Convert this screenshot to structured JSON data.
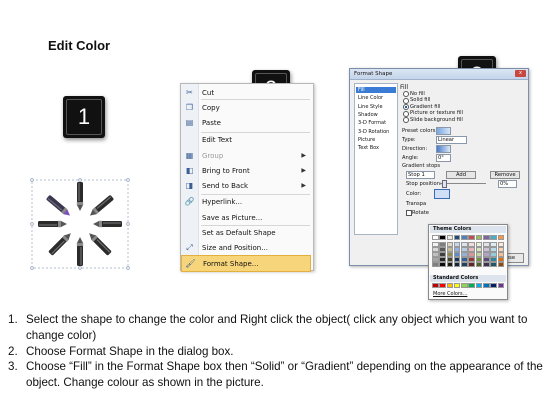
{
  "title": "Edit Color",
  "badges": [
    "1",
    "2",
    "3"
  ],
  "context_menu": {
    "items": [
      {
        "label": "Cut",
        "icon": "scissors-icon",
        "glyph": "✂",
        "enabled": true
      },
      {
        "label": "Copy",
        "icon": "copy-icon",
        "glyph": "❐",
        "enabled": true
      },
      {
        "label": "Paste",
        "icon": "paste-icon",
        "glyph": "▤",
        "enabled": true
      },
      {
        "label": "Edit Text",
        "icon": "edit-text-icon",
        "glyph": "",
        "enabled": true
      },
      {
        "label": "Group",
        "icon": "group-icon",
        "glyph": "▦",
        "enabled": false,
        "submenu": true
      },
      {
        "label": "Bring to Front",
        "icon": "bring-to-front-icon",
        "glyph": "◧",
        "enabled": true,
        "submenu": true
      },
      {
        "label": "Send to Back",
        "icon": "send-to-back-icon",
        "glyph": "◨",
        "enabled": true,
        "submenu": true
      },
      {
        "label": "Hyperlink...",
        "icon": "hyperlink-icon",
        "glyph": "🔗",
        "enabled": true
      },
      {
        "label": "Save as Picture...",
        "icon": "",
        "glyph": "",
        "enabled": true
      },
      {
        "label": "Set as Default Shape",
        "icon": "",
        "glyph": "",
        "enabled": true
      },
      {
        "label": "Size and Position...",
        "icon": "size-position-icon",
        "glyph": "⤢",
        "enabled": true
      },
      {
        "label": "Format Shape...",
        "icon": "format-shape-icon",
        "glyph": "🖌",
        "enabled": true,
        "selected": true
      }
    ]
  },
  "format_dialog": {
    "title": "Format Shape",
    "close": "x",
    "categories": [
      "Fill",
      "Line Color",
      "Line Style",
      "Shadow",
      "3-D Format",
      "3-D Rotation",
      "Picture",
      "Text Box"
    ],
    "selected_category": "Fill",
    "section": "Fill",
    "fill_options": [
      "No fill",
      "Solid fill",
      "Gradient fill",
      "Picture or texture fill",
      "Slide background fill"
    ],
    "selected_fill": "Gradient fill",
    "preset_label": "Preset colors:",
    "type_label": "Type:",
    "type_value": "Linear",
    "direction_label": "Direction:",
    "angle_label": "Angle:",
    "angle_value": "0°",
    "gradient_stops_label": "Gradient stops",
    "stop_value": "Stop 1",
    "add_label": "Add",
    "remove_label": "Remove",
    "stop_position_label": "Stop position:",
    "stop_position_value": "0%",
    "color_label": "Color:",
    "transparency_label": "Transpa",
    "rotate_label": "Rotate",
    "close_button": "Close"
  },
  "color_popup": {
    "theme_header": "Theme Colors",
    "standard_header": "Standard Colors",
    "more_colors": "More Colors...",
    "theme_top": [
      "#ffffff",
      "#000000",
      "#eeece1",
      "#1f497d",
      "#4f81bd",
      "#c0504d",
      "#9bbb59",
      "#8064a2",
      "#4bacc6",
      "#f79646"
    ],
    "theme_shades": [
      [
        "#f2f2f2",
        "#7f7f7f",
        "#ddd9c3",
        "#c6d9f0",
        "#dbe5f1",
        "#f2dcdb",
        "#ebf1dd",
        "#e5e0ec",
        "#dbeef3",
        "#fdeada"
      ],
      [
        "#d8d8d8",
        "#595959",
        "#c4bd97",
        "#8db3e2",
        "#b8cce4",
        "#e5b9b7",
        "#d7e3bc",
        "#ccc1d9",
        "#b7dde8",
        "#fbd5b5"
      ],
      [
        "#bfbfbf",
        "#3f3f3f",
        "#938953",
        "#548dd4",
        "#95b3d7",
        "#d99694",
        "#c3d69b",
        "#b2a2c7",
        "#92cddc",
        "#fac08f"
      ],
      [
        "#a5a5a5",
        "#262626",
        "#494429",
        "#17365d",
        "#366092",
        "#953734",
        "#76923c",
        "#5f497a",
        "#31859b",
        "#e36c09"
      ],
      [
        "#7f7f7f",
        "#0c0c0c",
        "#1d1b10",
        "#0f243e",
        "#244061",
        "#632423",
        "#4f6128",
        "#3f3151",
        "#205867",
        "#974806"
      ]
    ],
    "standard": [
      "#c00000",
      "#ff0000",
      "#ffc000",
      "#ffff00",
      "#92d050",
      "#00b050",
      "#00b0f0",
      "#0070c0",
      "#002060",
      "#7030a0"
    ]
  },
  "instructions": [
    {
      "num": "1.",
      "text": "Select the shape to change the color and Right click the object( click any object which you want to change color)"
    },
    {
      "num": "2.",
      "text": "Choose Format Shape in the dialog box."
    },
    {
      "num": "3.",
      "text": "Choose “Fill” in the Format Shape box then “Solid” or “Gradient” depending on the appearance of the object. Change colour as shown in the picture."
    }
  ]
}
